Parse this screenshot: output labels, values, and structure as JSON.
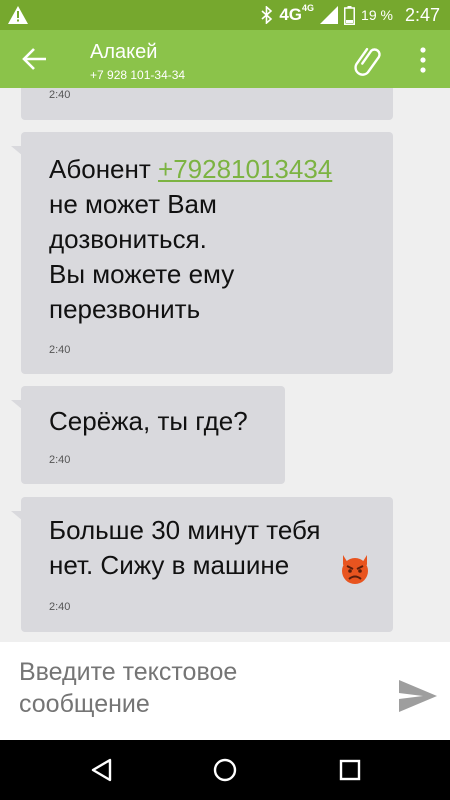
{
  "status_bar": {
    "network": "4G",
    "network_sup": "4G",
    "battery_percent": "19 %",
    "time": "2:47",
    "icons": [
      "warning-icon",
      "bluetooth-icon",
      "signal-icon",
      "battery-icon"
    ]
  },
  "header": {
    "title": "Алакей",
    "subtitle": "+7 928 101-34-34",
    "icons": [
      "back-arrow-icon",
      "paperclip-icon",
      "more-vert-icon"
    ]
  },
  "messages": [
    {
      "text": "",
      "time": "2:40"
    },
    {
      "text_before_link": "Абонент ",
      "link": "+79281013434",
      "text_after_link": "не может Вам\nдозвониться.\nВы можете ему\nперезвонить",
      "time": "2:40"
    },
    {
      "text": "Серёжа, ты где?",
      "time": "2:40"
    },
    {
      "text": "Больше 30 минут тебя\nнет. Сижу в машине",
      "emoji": "angry-devil-emoji",
      "time": "2:40"
    }
  ],
  "compose": {
    "placeholder": "Введите текстовое сообщение",
    "send_icon": "send-icon"
  },
  "nav_bar": {
    "icons": [
      "back-triangle-icon",
      "home-circle-icon",
      "recents-square-icon"
    ]
  },
  "colors": {
    "status_bar": "#76a82e",
    "app_bar": "#8bc34a",
    "bubble": "#d9d9dd",
    "link": "#7cb342"
  }
}
